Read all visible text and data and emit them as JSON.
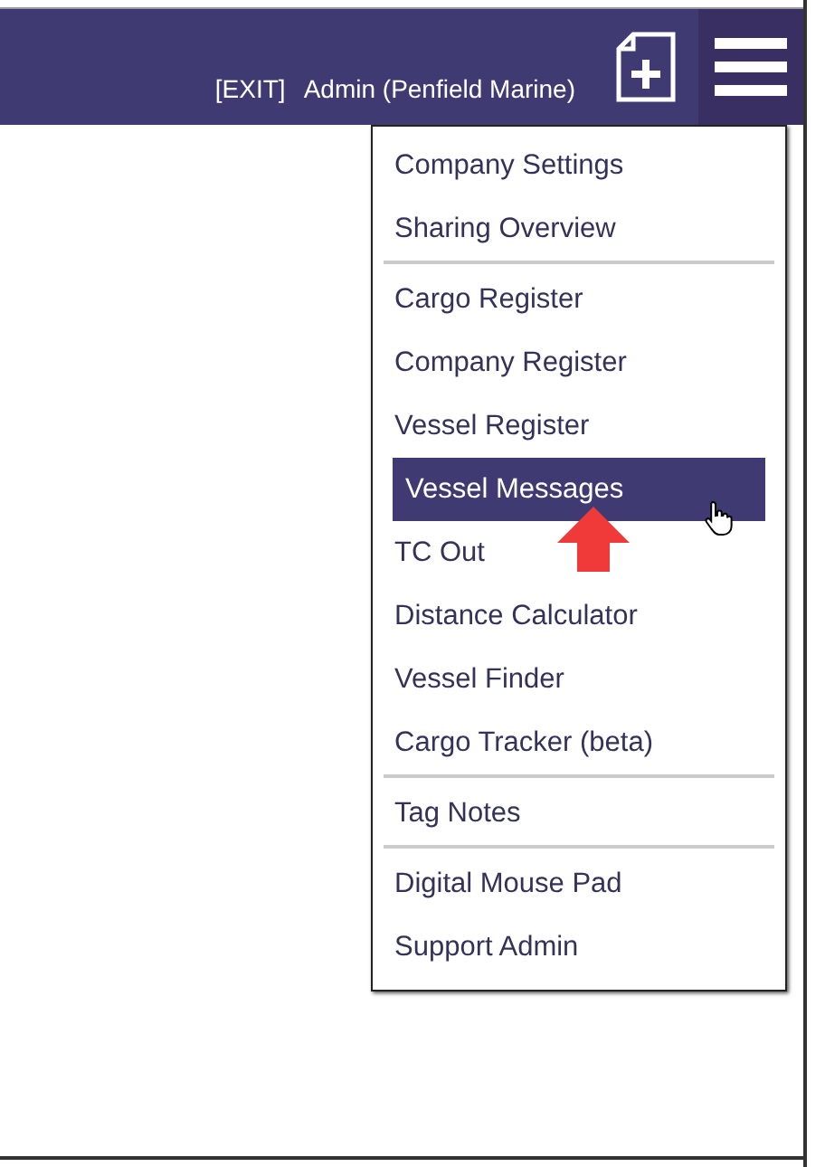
{
  "header": {
    "exit_link": "[EXIT]",
    "user": "Admin (Penfield Marine)"
  },
  "menu": {
    "expanded": true,
    "groups": [
      {
        "items": [
          {
            "label": "Company Settings",
            "selected": false
          },
          {
            "label": "Sharing Overview",
            "selected": false
          }
        ]
      },
      {
        "items": [
          {
            "label": "Cargo Register",
            "selected": false
          },
          {
            "label": "Company Register",
            "selected": false
          },
          {
            "label": "Vessel Register",
            "selected": false
          },
          {
            "label": "Vessel Messages",
            "selected": true
          },
          {
            "label": "TC Out",
            "selected": false
          },
          {
            "label": "Distance Calculator",
            "selected": false
          },
          {
            "label": "Vessel Finder",
            "selected": false
          },
          {
            "label": "Cargo Tracker (beta)",
            "selected": false
          }
        ]
      },
      {
        "items": [
          {
            "label": "Tag Notes",
            "selected": false
          }
        ]
      },
      {
        "items": [
          {
            "label": "Digital Mouse Pad",
            "selected": false
          },
          {
            "label": "Support Admin",
            "selected": false
          }
        ]
      }
    ]
  }
}
